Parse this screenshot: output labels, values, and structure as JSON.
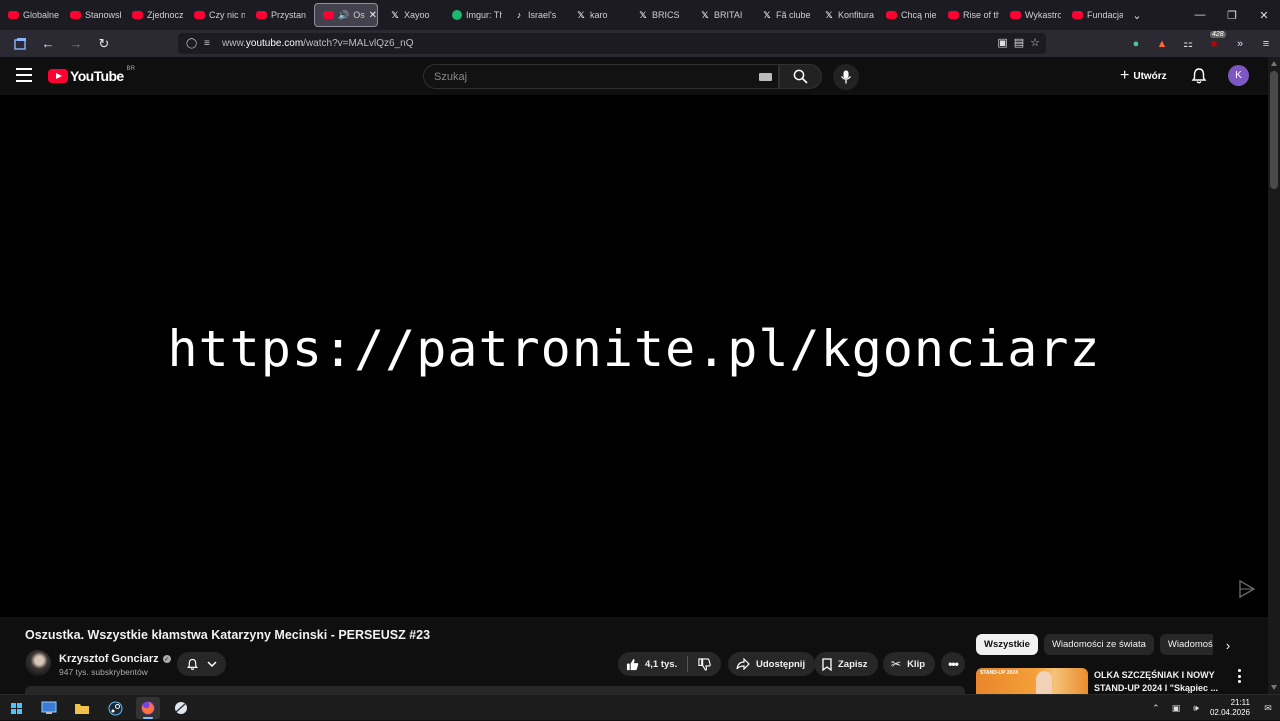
{
  "browser": {
    "tabs": [
      {
        "title": "Globalne",
        "icon": "youtube-icon"
      },
      {
        "title": "Stanowsk",
        "icon": "youtube-icon"
      },
      {
        "title": "Zjednocz",
        "icon": "youtube-icon"
      },
      {
        "title": "Czy nic n",
        "icon": "youtube-icon"
      },
      {
        "title": "Przystan",
        "icon": "youtube-icon"
      },
      {
        "title": "Os",
        "icon": "youtube-icon",
        "active": true
      },
      {
        "title": "Xayoo",
        "icon": "x-icon"
      },
      {
        "title": "Imgur: Th",
        "icon": "imgur-icon"
      },
      {
        "title": "Israel's",
        "icon": "tiktok-icon"
      },
      {
        "title": "karo",
        "icon": "x-icon"
      },
      {
        "title": "BRICS",
        "icon": "x-icon"
      },
      {
        "title": "BRITAI",
        "icon": "x-icon"
      },
      {
        "title": "Fã clube",
        "icon": "x-icon"
      },
      {
        "title": "Konfitura",
        "icon": "x-icon"
      },
      {
        "title": "Chcą niel",
        "icon": "youtube-icon"
      },
      {
        "title": "Rise of th",
        "icon": "youtube-icon"
      },
      {
        "title": "Wykastro",
        "icon": "youtube-icon"
      },
      {
        "title": "Fundacja",
        "icon": "youtube-icon"
      }
    ],
    "url_prefix": "www.",
    "url_domain": "youtube.com",
    "url_path": "/watch?v=MALvlQz6_nQ",
    "extension_badge": "428"
  },
  "youtube": {
    "logo_text": "YouTube",
    "country_code": "BR",
    "search_placeholder": "Szukaj",
    "create_label": "Utwórz",
    "avatar_letter": "K",
    "video_overlay_text": "https://patronite.pl/kgonciarz",
    "video_title": "Oszustka. Wszystkie kłamstwa Katarzyny Mecinski - PERSEUSZ #23",
    "channel_name": "Krzysztof Gonciarz",
    "subscribers": "947 tys. subskrybentów",
    "likes": "4,1 tys.",
    "share_label": "Udostępnij",
    "save_label": "Zapisz",
    "clip_label": "Klip",
    "chips": [
      "Wszystkie",
      "Wiadomości ze świata",
      "Wiadomości"
    ],
    "related": {
      "thumb_tag": "STAND-UP 2024",
      "title": "OLKA SZCZĘŚNIAK I NOWY STAND-UP 2024 I \"Skąpiec ..."
    }
  },
  "taskbar": {
    "time": "21:11",
    "date": "02.04.2026"
  },
  "colors": {
    "youtube_red": "#ff0033",
    "avatar_purple": "#7e57c2",
    "windows_blue": "#4cc2ff"
  }
}
